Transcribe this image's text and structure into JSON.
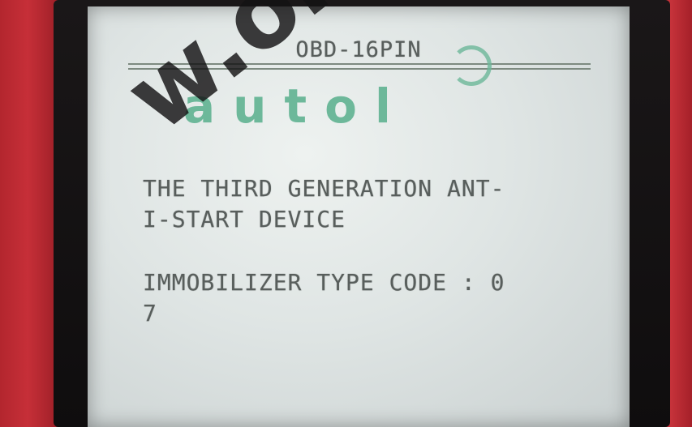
{
  "screen": {
    "header": "OBD-16PIN",
    "logo": "autol",
    "lines": [
      "THE THIRD GENERATION ANT-",
      "I-START DEVICE",
      "IMMOBILIZER TYPE CODE : 0",
      "7"
    ]
  },
  "watermark": "w.obdtools.",
  "colors": {
    "casing": "#b3262e",
    "lcd_background": "#dfe5e4",
    "lcd_text": "#585e5c",
    "logo": "#6db89a"
  }
}
